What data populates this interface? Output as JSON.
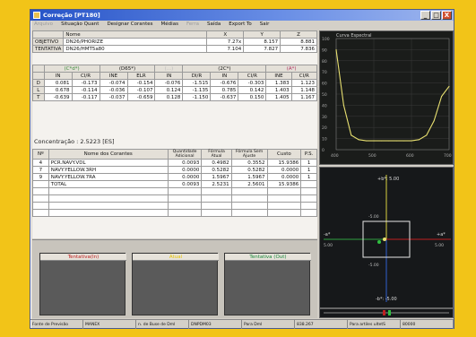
{
  "window": {
    "title": "Correção [PT180]",
    "controls": [
      "_",
      "□",
      "X"
    ]
  },
  "menu": [
    {
      "label": "Arquivo",
      "enabled": false
    },
    {
      "label": "Situação Quant",
      "enabled": true
    },
    {
      "label": "Designar Corantes",
      "enabled": true
    },
    {
      "label": "Médias",
      "enabled": true
    },
    {
      "label": "Ferra",
      "enabled": false
    },
    {
      "label": "Saída",
      "enabled": true
    },
    {
      "label": "Export To",
      "enabled": true
    },
    {
      "label": "Sair",
      "enabled": true
    }
  ],
  "measure_table": {
    "headers": [
      "",
      "Nome",
      "X",
      "Y",
      "Z"
    ],
    "rows": [
      {
        "label": "OBJETIVO",
        "name": "DN26/PHORIZE",
        "x": "7.27x",
        "y": "8.157",
        "z": "8.881"
      },
      {
        "label": "TENTATIVA",
        "name": "DN26/HMT5a80",
        "x": "7.104",
        "y": "7.827",
        "z": "7.836"
      }
    ]
  },
  "diff_table": {
    "groups": [
      {
        "label": "(C*d*)",
        "style": "green"
      },
      {
        "label": "(D65*)",
        "style": "normal"
      },
      {
        "label": "(...)",
        "style": "light"
      },
      {
        "label": "(2C*)",
        "style": "normal"
      },
      {
        "label": "(A*)",
        "style": "pink"
      }
    ],
    "headers": [
      "",
      "IN",
      "CI/R",
      "INE",
      "ELR",
      "IN",
      "DI/R",
      "IN",
      "CI/R",
      "INE",
      "CI/R"
    ],
    "rows": [
      [
        "D",
        "0.081",
        "-0.173",
        "-0.074",
        "-0.154",
        "-0.076",
        "-1.515",
        "-0.676",
        "-0.303",
        "1.383",
        "1.123"
      ],
      [
        "L",
        "0.678",
        "-0.114",
        "-0.036",
        "-0.107",
        "0.124",
        "-1.135",
        "0.785",
        "0.142",
        "1.403",
        "1.148"
      ],
      [
        "T",
        "-0.639",
        "-0.117",
        "-0.037",
        "-0.659",
        "0.128",
        "-1.150",
        "-0.637",
        "0.150",
        "1.405",
        "1.167"
      ]
    ]
  },
  "caption": "Concentração : 2.5223 [ES]",
  "colorant_table": {
    "headers": [
      "Nº",
      "Nome dos Corantes",
      "Quantidade Adicional",
      "Fórmula Atual",
      "Fórmula Sem Ajuste",
      "Custo",
      "P.S."
    ],
    "rows": [
      [
        "4",
        "PCR.NAVY.VDL",
        "0.0093",
        "0.4982",
        "0.3552",
        "15.9386",
        "1"
      ],
      [
        "7",
        "NAVY.YELLOW.3RH",
        "0.0000",
        "0.5282",
        "0.5282",
        "0.0000",
        "1"
      ],
      [
        "9",
        "NAVY.YELLOW.7RA",
        "0.0000",
        "1.5967",
        "1.5967",
        "0.0000",
        "1"
      ],
      [
        "",
        "TOTAL",
        "0.0093",
        "2.5231",
        "2.5601",
        "15.9386",
        ""
      ]
    ]
  },
  "swatches": [
    {
      "label": "Tentativa(In)",
      "label_color": "#c02020"
    },
    {
      "label": "Atual",
      "label_color": "#e6c400"
    },
    {
      "label": "Tentativa (Out)",
      "label_color": "#1a8a3a"
    }
  ],
  "spectral_graph": {
    "header": "Curva Espectral",
    "y_ticks": [
      "100",
      "90",
      "80",
      "70",
      "60",
      "50",
      "40",
      "30",
      "20",
      "10",
      "0"
    ],
    "x_ticks": [
      "400",
      "500",
      "600",
      "700"
    ]
  },
  "color_plane": {
    "top_label": "+b*: 5.00",
    "bottom_label": "-b*: -5.00",
    "left_label": "-a*",
    "right_label": "+a*",
    "left_value": "5.00",
    "right_value": "5.00",
    "top_value": "-5.00",
    "bottom_value": "-5.00"
  },
  "chart_data": {
    "type": "line",
    "title": "Curva Espectral",
    "xlabel": "",
    "ylabel": "",
    "x": [
      400,
      420,
      440,
      460,
      480,
      500,
      520,
      540,
      560,
      580,
      600,
      620,
      640,
      660,
      680,
      700
    ],
    "series": [
      {
        "values": [
          90,
          40,
          13,
          9,
          8,
          8,
          8,
          8,
          8,
          8,
          8,
          9,
          13,
          26,
          48,
          57
        ]
      }
    ],
    "xlim": [
      400,
      700
    ],
    "ylim": [
      0,
      100
    ],
    "grid": true,
    "color": "#e8e070"
  },
  "status_bar": [
    "Fonte de Previsão",
    "MANEX",
    "n. de Buse de Dml",
    "DNPDM03",
    "Para Dml",
    "838.267",
    "Para artiles ultetS",
    "80000"
  ]
}
